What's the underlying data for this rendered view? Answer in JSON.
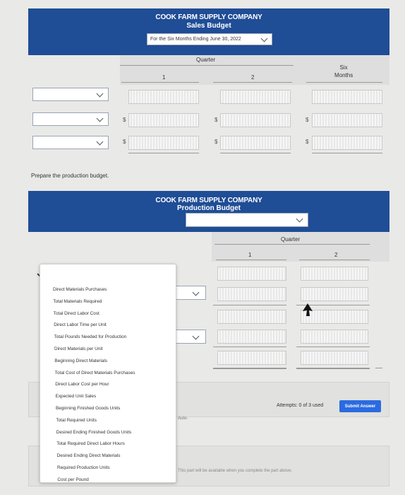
{
  "sales_budget": {
    "company": "COOK FARM SUPPLY COMPANY",
    "title": "Sales Budget",
    "period_select": "For the Six Months Ending June 30, 2022",
    "quarter_label": "Quarter",
    "col1": "1",
    "col2": "2",
    "col3": "Six\nMonths",
    "dollar": "$"
  },
  "prompt": "Prepare the production budget.",
  "production_budget": {
    "company": "COOK FARM SUPPLY COMPANY",
    "title": "Production Budget",
    "period_select": "",
    "quarter_label": "Quarter",
    "col1": "1",
    "col2": "2"
  },
  "dropdown_options": [
    "Direct Materials Purchases",
    "Total Materials Required",
    "Total Direct Labor Cost",
    "Direct Labor Time per Unit",
    "Total Pounds Needed for Production",
    "Direct Materials per Unit",
    "Beginning Direct Materials",
    "Total Cost of Direct Materials Purchases",
    "Direct Labor Cost per Hour",
    "Expected Unit Sales",
    "Beginning Finished Goods Units",
    "Total Required Units",
    "Desired Ending Finished Goods Units",
    "Total Required Direct Labor Hours",
    "Desired Ending Direct Materials",
    "Required Production Units",
    "Cost per Pound"
  ],
  "attempts": "Attempts: 0 of 3 used",
  "submit_label": "Submit Answer",
  "auto_text": "Auto-",
  "part_note": "This part will be available when you complete the part above."
}
